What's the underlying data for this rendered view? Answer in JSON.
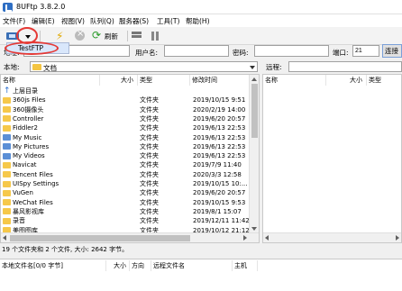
{
  "window": {
    "title": "8UFtp 3.8.2.0"
  },
  "menu": [
    {
      "label": "文件(F)"
    },
    {
      "label": "编辑(E)"
    },
    {
      "label": "视图(V)"
    },
    {
      "label": "队列(Q)"
    },
    {
      "label": "服务器(S)"
    },
    {
      "label": "工具(T)"
    },
    {
      "label": "帮助(H)"
    }
  ],
  "toolbar": {
    "refresh_label": "刷新",
    "dropdown_item": "TestFTP"
  },
  "connection": {
    "address_label": "地址:",
    "user_label": "用户名:",
    "password_label": "密码:",
    "port_label": "端口:",
    "port_value": "21",
    "connect_label": "连接"
  },
  "local": {
    "label": "本地:",
    "path": "文档",
    "columns": [
      "名称",
      "大小",
      "类型",
      "修改时间"
    ],
    "rows": [
      {
        "name": "上层目录",
        "type": "",
        "date": "",
        "icon": "up"
      },
      {
        "name": "360js Files",
        "type": "文件夹",
        "date": "2019/10/15 9:51",
        "icon": "folder"
      },
      {
        "name": "360摄像头",
        "type": "文件夹",
        "date": "2020/2/19 14:00",
        "icon": "folder"
      },
      {
        "name": "Controller",
        "type": "文件夹",
        "date": "2019/6/20 20:57",
        "icon": "folder"
      },
      {
        "name": "Fiddler2",
        "type": "文件夹",
        "date": "2019/6/13 22:53",
        "icon": "folder"
      },
      {
        "name": "My Music",
        "type": "文件夹",
        "date": "2019/6/13 22:53",
        "icon": "special"
      },
      {
        "name": "My Pictures",
        "type": "文件夹",
        "date": "2019/6/13 22:53",
        "icon": "special"
      },
      {
        "name": "My Videos",
        "type": "文件夹",
        "date": "2019/6/13 22:53",
        "icon": "special"
      },
      {
        "name": "Navicat",
        "type": "文件夹",
        "date": "2019/7/9 11:40",
        "icon": "folder"
      },
      {
        "name": "Tencent Files",
        "type": "文件夹",
        "date": "2020/3/3 12:58",
        "icon": "folder"
      },
      {
        "name": "UISpy Settings",
        "type": "文件夹",
        "date": "2019/10/15 10:...",
        "icon": "folder"
      },
      {
        "name": "VuGen",
        "type": "文件夹",
        "date": "2019/6/20 20:57",
        "icon": "folder"
      },
      {
        "name": "WeChat Files",
        "type": "文件夹",
        "date": "2019/10/15 9:53",
        "icon": "folder"
      },
      {
        "name": "暴风影视库",
        "type": "文件夹",
        "date": "2019/8/1 15:07",
        "icon": "folder"
      },
      {
        "name": "录音",
        "type": "文件夹",
        "date": "2019/12/11 11:42",
        "icon": "folder"
      },
      {
        "name": "美图图库",
        "type": "文件夹",
        "date": "2019/10/12 21:12",
        "icon": "folder"
      }
    ],
    "status": "19 个文件夹和 2 个文件, 大小: 2642 字节。"
  },
  "remote": {
    "label": "远程:",
    "columns": [
      "名称",
      "大小",
      "类型"
    ]
  },
  "queue": {
    "columns": [
      "本地文件名[0/0 字节]",
      "大小",
      "方向",
      "远程文件名",
      "主机"
    ]
  },
  "colors": {
    "accent": "#2f6fc4",
    "highlight": "#e53935",
    "folder": "#f6c84a"
  }
}
